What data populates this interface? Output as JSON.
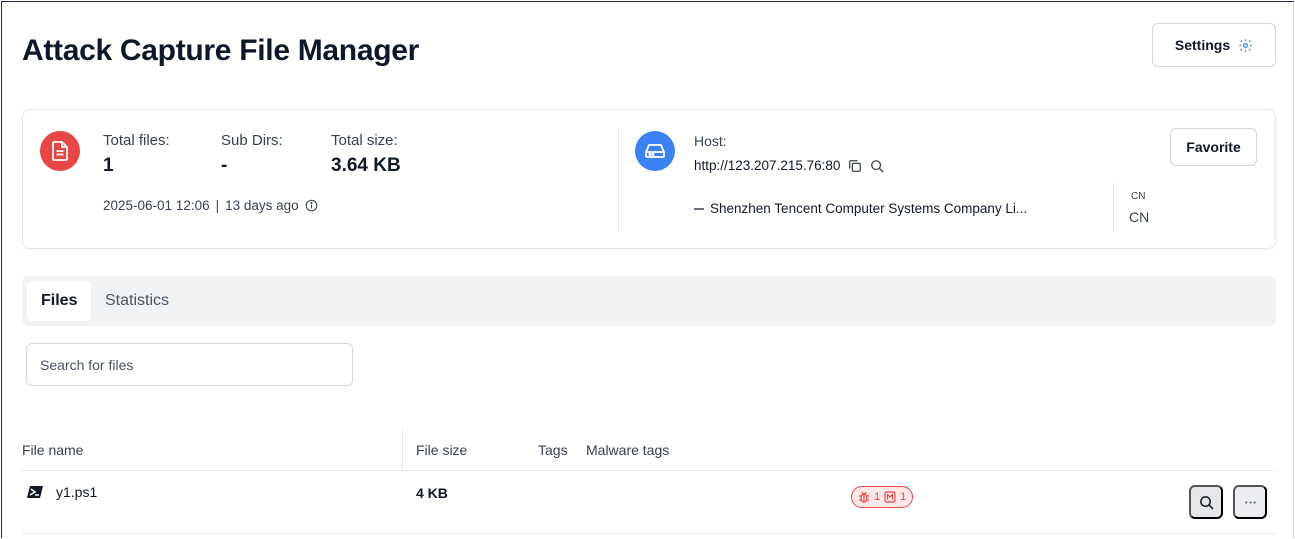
{
  "header": {
    "title": "Attack Capture File Manager",
    "settings_label": "Settings"
  },
  "summary": {
    "total_files_label": "Total files:",
    "total_files_value": "1",
    "sub_dirs_label": "Sub Dirs:",
    "sub_dirs_value": "-",
    "total_size_label": "Total size:",
    "total_size_value": "3.64 KB",
    "timestamp": "2025-06-01 12:06",
    "relative_time": "13 days ago",
    "host_label": "Host:",
    "host_url": "http://123.207.215.76:80",
    "organization": "Shenzhen Tencent Computer Systems Company Li...",
    "country_code_small": "CN",
    "country_code": "CN",
    "favorite_label": "Favorite"
  },
  "tabs": [
    {
      "label": "Files",
      "active": true
    },
    {
      "label": "Statistics",
      "active": false
    }
  ],
  "search": {
    "placeholder": "Search for files",
    "value": ""
  },
  "table": {
    "columns": [
      "File name",
      "File size",
      "Tags",
      "Malware tags"
    ],
    "rows": [
      {
        "name": "y1.ps1",
        "size": "4 KB",
        "malware_badge": {
          "bug_count": "1",
          "m_count": "1"
        }
      }
    ]
  },
  "colors": {
    "accent_red": "#e84545",
    "accent_blue": "#3b82f6",
    "tab_bg": "#f1f2f4",
    "border": "#d1d5db"
  },
  "icons": {
    "settings": "gear-icon",
    "file_doc": "document-icon",
    "host": "server-icon",
    "copy": "copy-icon",
    "search": "search-icon",
    "info": "info-icon",
    "powershell": "powershell-icon",
    "bug": "bug-icon",
    "more": "more-icon"
  }
}
